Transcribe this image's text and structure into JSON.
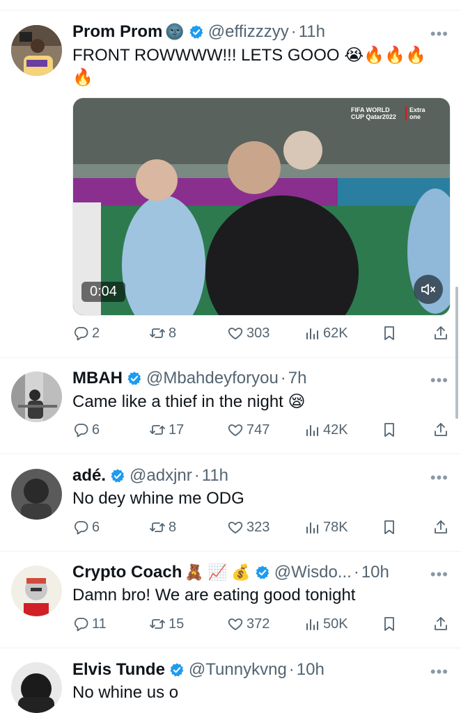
{
  "colors": {
    "accent": "#1d9bf0",
    "text": "#0f1419",
    "secondary": "#536471",
    "border": "#eff3f4"
  },
  "tweets": [
    {
      "name": "Prom Prom",
      "name_emoji": "🌚",
      "handle": "@effizzzyy",
      "sep": "·",
      "time": "11h",
      "text": "FRONT ROWWWW!!! LETS GOOO 😭🔥🔥🔥🔥",
      "media": {
        "duration": "0:04",
        "broadcast_title": "FIFA WORLD CUP Qatar2022",
        "broadcast_channel": "Extra one"
      },
      "replies": "2",
      "reposts": "8",
      "likes": "303",
      "views": "62K"
    },
    {
      "name": "MBAH",
      "handle": "@Mbahdeyforyou",
      "sep": "·",
      "time": "7h",
      "text": "Came like a thief in the night 😪",
      "replies": "6",
      "reposts": "17",
      "likes": "747",
      "views": "42K"
    },
    {
      "name": "adé.",
      "handle": "@adxjnr",
      "sep": "·",
      "time": "11h",
      "text": "No dey whine me ODG",
      "replies": "6",
      "reposts": "8",
      "likes": "323",
      "views": "78K"
    },
    {
      "name": "Crypto Coach",
      "name_emoji": "🧸 📈 💰",
      "handle": "@Wisdo...",
      "sep": "·",
      "time": "10h",
      "text": "Damn bro! We are eating good tonight",
      "replies": "11",
      "reposts": "15",
      "likes": "372",
      "views": "50K"
    },
    {
      "name": "Elvis Tunde",
      "handle": "@Tunnykvng",
      "sep": "·",
      "time": "10h",
      "text": "No whine us o"
    }
  ],
  "more_label": "•••"
}
